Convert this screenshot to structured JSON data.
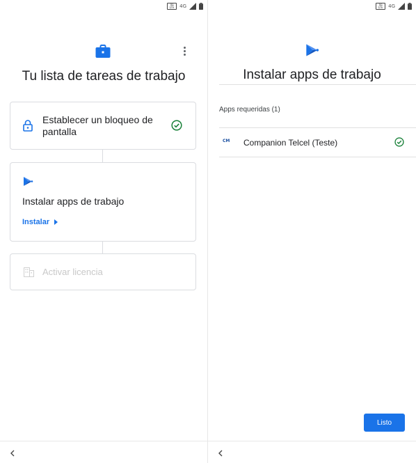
{
  "status_bar": {
    "volte": "VoLTE",
    "network": "4G"
  },
  "left_screen": {
    "title": "Tu lista de tareas de trabajo",
    "header_icon": "briefcase-icon",
    "menu_icon": "more-vert-icon",
    "steps": [
      {
        "label": "Establecer un bloqueo de pantalla",
        "icon": "lock-icon",
        "status": "completed"
      },
      {
        "label": "Instalar apps de trabajo",
        "icon": "play-icon",
        "action_label": "Instalar",
        "status": "active"
      },
      {
        "label": "Activar licencia",
        "icon": "building-icon",
        "status": "disabled"
      }
    ]
  },
  "right_screen": {
    "title": "Instalar apps de trabajo",
    "header_icon": "play-icon",
    "section_label": "Apps requeridas (1)",
    "apps": [
      {
        "name": "Companion Telcel (Teste)",
        "logo_text": "CM",
        "status": "installed"
      }
    ],
    "done_button": "Listo"
  },
  "navigation": {
    "back_icon": "chevron-left-icon"
  },
  "colors": {
    "accent": "#1a73e8",
    "success": "#188038",
    "disabled_text": "#c8c8c8",
    "divider": "#dadce0"
  }
}
